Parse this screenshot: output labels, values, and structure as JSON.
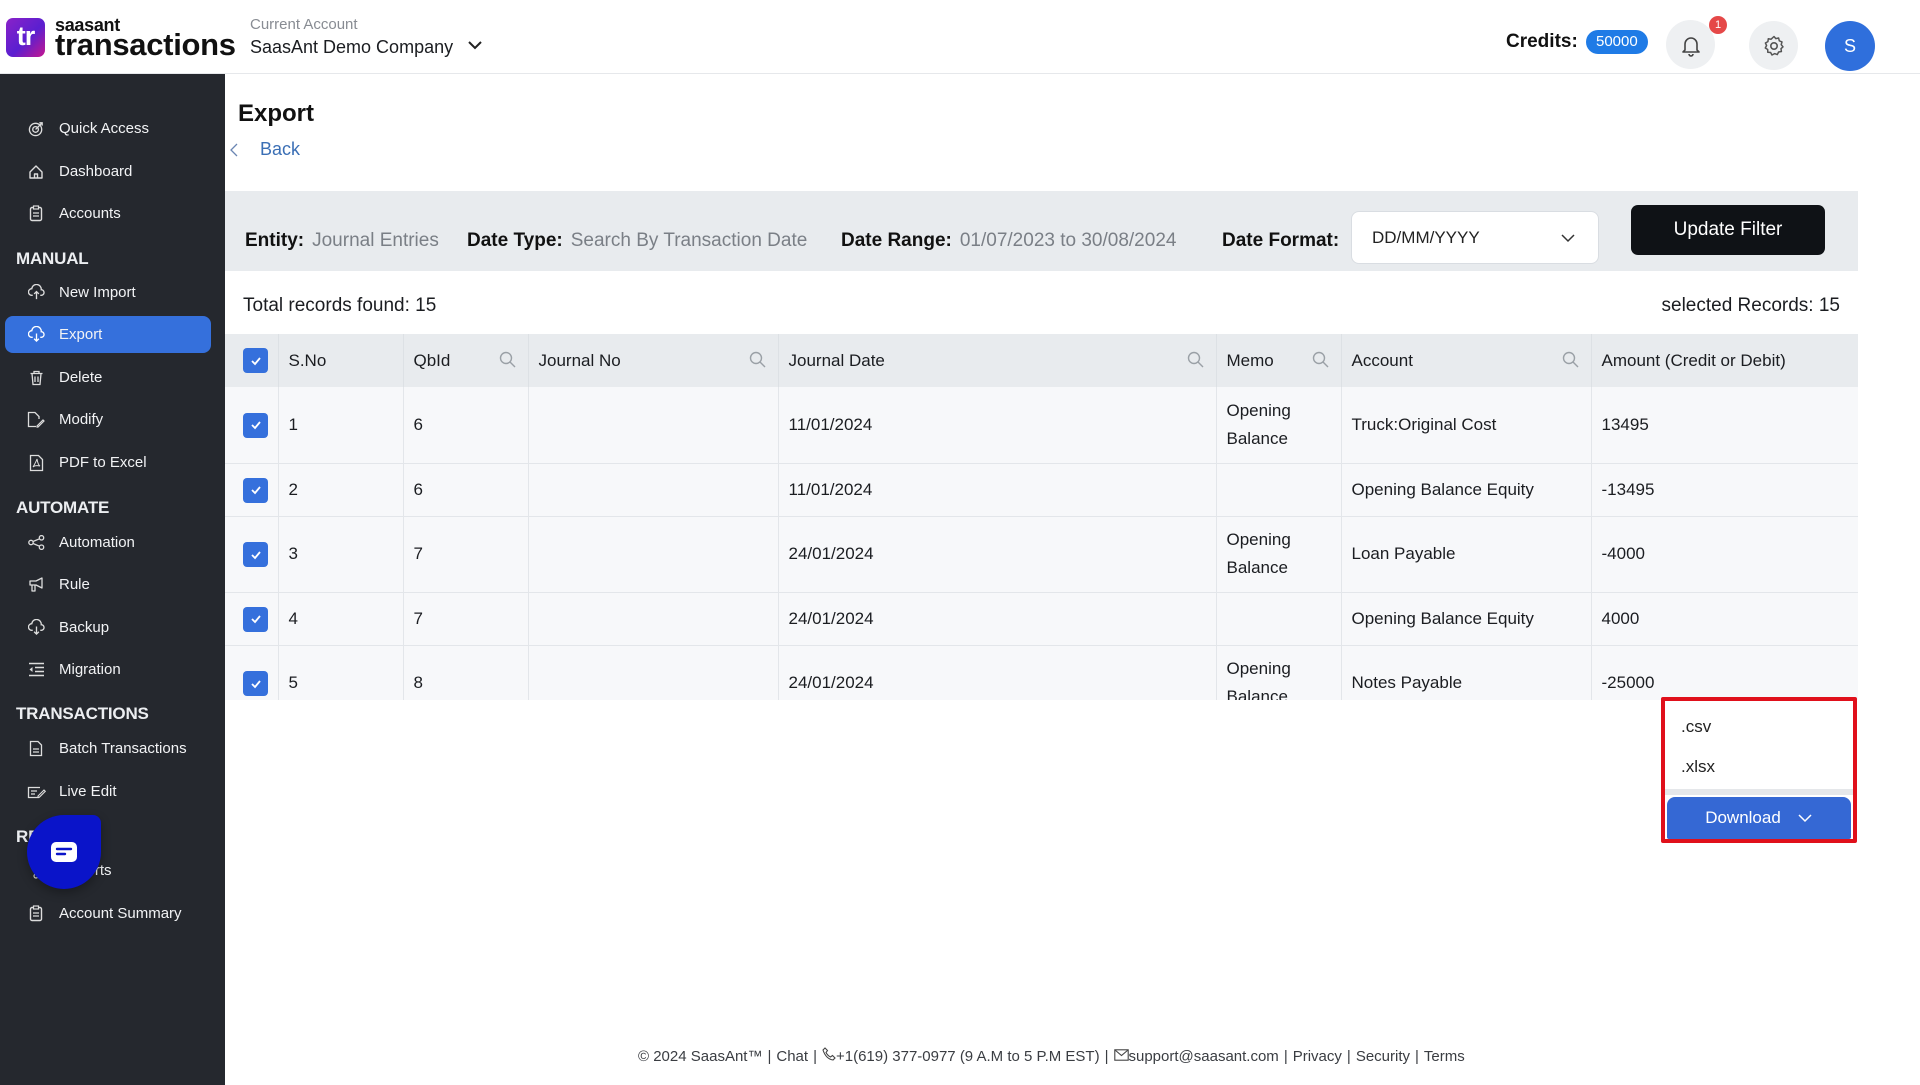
{
  "header": {
    "logo_text": "tr",
    "brand_small": "saasant",
    "brand_big": "transactions",
    "account_label": "Current Account",
    "account_name": "SaasAnt Demo Company",
    "credits_label": "Credits:",
    "credits_value": "50000",
    "notification_count": "1",
    "avatar_initial": "S",
    "icons": {
      "account_dropdown": "chevron-down-icon",
      "notifications": "bell-icon",
      "settings": "gear-icon"
    }
  },
  "sidebar": {
    "items": [
      {
        "label": "Quick Access",
        "icon": "target-icon"
      },
      {
        "label": "Dashboard",
        "icon": "home-icon"
      },
      {
        "label": "Accounts",
        "icon": "clipboard-icon"
      }
    ],
    "sections": [
      {
        "title": "MANUAL",
        "items": [
          {
            "label": "New Import",
            "icon": "cloud-upload-icon"
          },
          {
            "label": "Export",
            "icon": "cloud-download-icon",
            "active": true
          },
          {
            "label": "Delete",
            "icon": "trash-icon"
          },
          {
            "label": "Modify",
            "icon": "edit-file-icon"
          },
          {
            "label": "PDF to Excel",
            "icon": "pdf-file-icon"
          }
        ]
      },
      {
        "title": "AUTOMATE",
        "items": [
          {
            "label": "Automation",
            "icon": "share-nodes-icon"
          },
          {
            "label": "Rule",
            "icon": "megaphone-icon"
          },
          {
            "label": "Backup",
            "icon": "cloud-download-icon"
          },
          {
            "label": "Migration",
            "icon": "indent-list-icon"
          }
        ]
      },
      {
        "title": "TRANSACTIONS",
        "items": [
          {
            "label": "Batch Transactions",
            "icon": "document-icon"
          },
          {
            "label": "Live Edit",
            "icon": "pencil-box-icon"
          }
        ]
      },
      {
        "title": "REPORTS",
        "items": [
          {
            "label": "Reports",
            "icon": "slider-icon"
          },
          {
            "label": "Account Summary",
            "icon": "clipboard-icon"
          }
        ]
      }
    ]
  },
  "chat_widget": {
    "icon": "chat-icon"
  },
  "page": {
    "title": "Export",
    "back_label": "Back"
  },
  "filters": {
    "entity_label": "Entity:",
    "entity_value": "Journal Entries",
    "date_type_label": "Date Type:",
    "date_type_value": "Search By Transaction Date",
    "date_range_label": "Date Range:",
    "date_range_value": "01/07/2023 to 30/08/2024",
    "date_format_label": "Date Format:",
    "date_format_value": "DD/MM/YYYY",
    "update_button": "Update Filter"
  },
  "records": {
    "total": "Total records found: 15",
    "selected": "selected Records: 15"
  },
  "table": {
    "columns": [
      "S.No",
      "QbId",
      "Journal No",
      "Journal Date",
      "Memo",
      "Account",
      "Amount (Credit or Debit)"
    ],
    "searchable": [
      false,
      true,
      true,
      true,
      true,
      true,
      false
    ],
    "rows": [
      {
        "checked": true,
        "sno": "1",
        "qbid": "6",
        "journal_no": "",
        "journal_date": "11/01/2024",
        "memo": "Opening Balance",
        "account": "Truck:Original Cost",
        "amount": "13495"
      },
      {
        "checked": true,
        "sno": "2",
        "qbid": "6",
        "journal_no": "",
        "journal_date": "11/01/2024",
        "memo": "",
        "account": "Opening Balance Equity",
        "amount": "-13495"
      },
      {
        "checked": true,
        "sno": "3",
        "qbid": "7",
        "journal_no": "",
        "journal_date": "24/01/2024",
        "memo": "Opening Balance",
        "account": "Loan Payable",
        "amount": "-4000"
      },
      {
        "checked": true,
        "sno": "4",
        "qbid": "7",
        "journal_no": "",
        "journal_date": "24/01/2024",
        "memo": "",
        "account": "Opening Balance Equity",
        "amount": "4000"
      },
      {
        "checked": true,
        "sno": "5",
        "qbid": "8",
        "journal_no": "",
        "journal_date": "24/01/2024",
        "memo": "Opening Balance",
        "account": "Notes Payable",
        "amount": "-25000"
      }
    ]
  },
  "download": {
    "options": [
      ".csv",
      ".xlsx"
    ],
    "button_label": "Download"
  },
  "footer": {
    "copyright": "© 2024 SaasAnt™",
    "chat": "Chat",
    "phone": "+1(619) 377-0977 (9 A.M to 5 P.M EST)",
    "email": "support@saasant.com",
    "privacy": "Privacy",
    "security": "Security",
    "terms": "Terms"
  },
  "colors": {
    "accent": "#3570dc",
    "sidebar_bg": "#25282e",
    "highlight_border": "#e0101b",
    "credits_badge": "#1f7be6",
    "chat_widget": "#0a14c9"
  }
}
